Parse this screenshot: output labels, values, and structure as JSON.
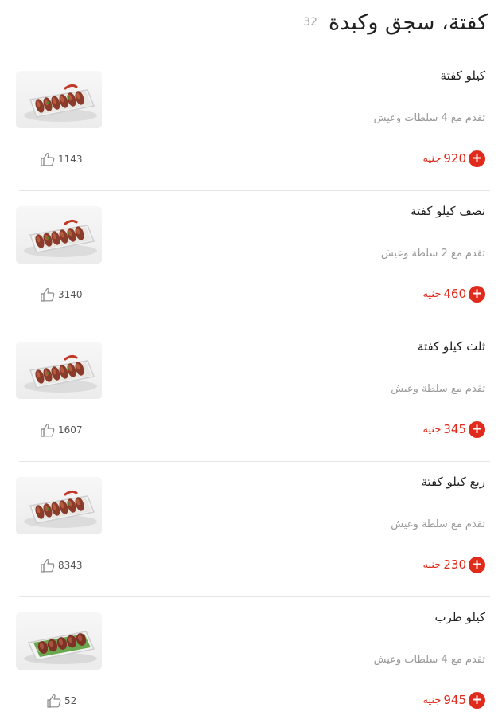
{
  "category": {
    "title": "كفتة، سجق وكبدة",
    "count": "32"
  },
  "currency_label": "جنيه",
  "items": [
    {
      "name": "كيلو كفتة",
      "description": "تقدم مع 4 سلطات وعيش",
      "price": "920",
      "likes": "1143",
      "image": "kofta-tray"
    },
    {
      "name": "نصف كيلو كفتة",
      "description": "تقدم مع 2 سلطة وعيش",
      "price": "460",
      "likes": "3140",
      "image": "kofta-tray"
    },
    {
      "name": "ثلث كيلو كفتة",
      "description": "تقدم مع سلطة وعيش",
      "price": "345",
      "likes": "1607",
      "image": "kofta-tray"
    },
    {
      "name": "ربع كيلو كفتة",
      "description": "تقدم مع سلطة وعيش",
      "price": "230",
      "likes": "8343",
      "image": "kofta-tray"
    },
    {
      "name": "كيلو طرب",
      "description": "تقدم مع 4 سلطات وعيش",
      "price": "945",
      "likes": "52",
      "image": "tarb-tray"
    }
  ],
  "colors": {
    "accent": "#e02a1b",
    "muted": "#999999"
  },
  "icons": {
    "add": "plus-icon",
    "like": "thumbs-up-icon"
  }
}
